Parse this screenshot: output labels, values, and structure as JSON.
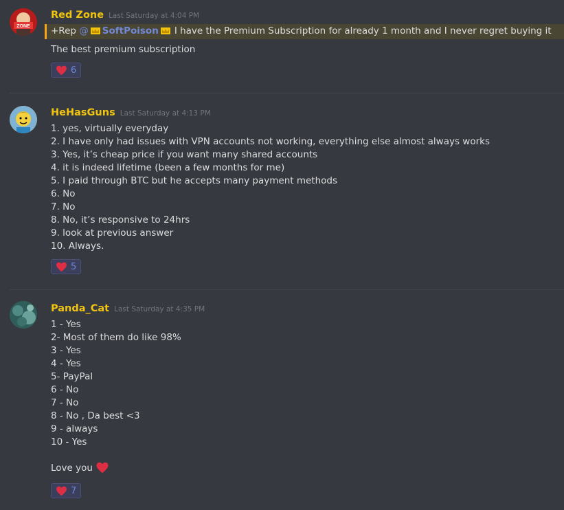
{
  "messages": [
    {
      "author": "Red Zone",
      "timestamp": "Last Saturday at 4:04 PM",
      "quote": {
        "prefix": "+Rep ",
        "at": "@",
        "mention_name": "SoftPoison",
        "text": "I have the Premium Subscription for already 1 month and I never regret buying it"
      },
      "lines": [
        "The best premium subscription"
      ],
      "reaction": {
        "icon": "heart-icon",
        "count": "6"
      }
    },
    {
      "author": "HeHasGuns",
      "timestamp": "Last Saturday at 4:13 PM",
      "lines": [
        "1. yes, virtually everyday",
        "2. I have only had issues with VPN accounts not working, everything else almost always works",
        "3. Yes, it’s cheap price if you want many shared accounts",
        "4. it is indeed lifetime (been a few months for me)",
        "5. I paid through BTC but he accepts many payment methods",
        "6. No",
        "7. No",
        "8. No, it’s responsive to 24hrs",
        "9. look at previous answer",
        "10. Always."
      ],
      "reaction": {
        "icon": "heart-icon",
        "count": "5"
      }
    },
    {
      "author": "Panda_Cat",
      "timestamp": "Last Saturday at 4:35 PM",
      "lines": [
        "1 - Yes",
        "2- Most of them do like 98%",
        "3 - Yes",
        "4 - Yes",
        "5- PayPal",
        "6 - No",
        "7 - No",
        "8 - No , Da best <3",
        "9 - always",
        "10 - Yes"
      ],
      "closing": "Love you",
      "reaction": {
        "icon": "heart-icon",
        "count": "7"
      }
    }
  ],
  "colors": {
    "background": "#36393f",
    "username": "#f1c40f",
    "mention": "#7289da",
    "heart": "#dd2e44"
  },
  "avatar_text": "ZONE"
}
